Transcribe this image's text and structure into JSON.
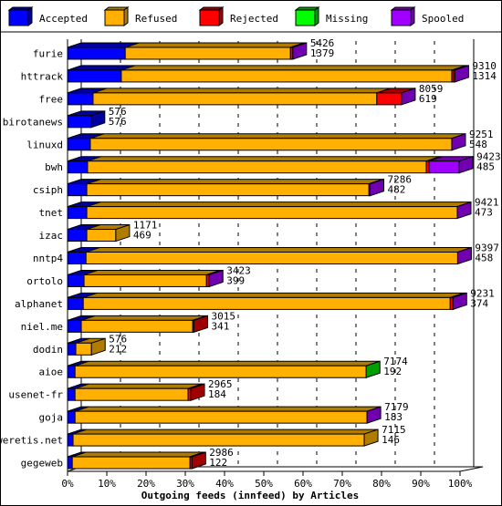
{
  "chart_data": {
    "type": "bar",
    "orientation": "horizontal",
    "stacked": true,
    "style": "3d",
    "title": "",
    "xlabel": "Outgoing feeds (innfeed) by Articles",
    "ylabel": "",
    "xlim": [
      0,
      100
    ],
    "x_unit": "%",
    "x_ticks": [
      "0%",
      "10%",
      "20%",
      "30%",
      "40%",
      "50%",
      "60%",
      "70%",
      "80%",
      "90%",
      "100%"
    ],
    "grid": true,
    "legend_position": "top",
    "legend": [
      {
        "name": "Accepted",
        "color": "#0000ff",
        "side": "#0000a0"
      },
      {
        "name": "Refused",
        "color": "#ffb000",
        "side": "#b07c00"
      },
      {
        "name": "Rejected",
        "color": "#ff0000",
        "side": "#a00000"
      },
      {
        "name": "Missing",
        "color": "#00ff00",
        "side": "#00a000"
      },
      {
        "name": "Spooled",
        "color": "#a000ff",
        "side": "#7000b0"
      }
    ],
    "categories": [
      "furie",
      "httrack",
      "free",
      "birotanews",
      "linuxd",
      "bwh",
      "csiph",
      "tnet",
      "izac",
      "nntp4",
      "ortolo",
      "alphanet",
      "niel.me",
      "dodin",
      "aioe",
      "usenet-fr",
      "goja",
      "weretis.net",
      "gegeweb"
    ],
    "series": [
      {
        "name": "Accepted",
        "values": [
          14.7,
          13.7,
          6.5,
          6.0,
          5.8,
          5.1,
          4.9,
          4.9,
          4.9,
          4.7,
          4.2,
          4.0,
          3.5,
          2.1,
          1.9,
          1.9,
          1.9,
          1.4,
          1.2
        ]
      },
      {
        "name": "Refused",
        "values": [
          42.1,
          84.2,
          72.3,
          0,
          92.1,
          86.3,
          71.9,
          94.4,
          7.4,
          94.7,
          31.2,
          93.5,
          28.4,
          4.0,
          74.2,
          28.8,
          74.4,
          74.2,
          30.0
        ]
      },
      {
        "name": "Rejected",
        "values": [
          0.6,
          0.5,
          6.3,
          0,
          0,
          0.7,
          0,
          0,
          0,
          0,
          0.7,
          0.7,
          0.3,
          0,
          0,
          0.7,
          0,
          0,
          0.5
        ]
      },
      {
        "name": "Missing",
        "values": [
          0,
          0.3,
          0,
          0,
          0,
          0,
          0,
          0,
          0,
          0,
          0,
          0,
          0,
          0,
          0,
          0,
          0,
          0,
          0
        ]
      },
      {
        "name": "Spooled",
        "values": [
          0,
          0,
          0,
          0,
          0,
          7.7,
          0.3,
          0,
          0,
          0,
          0,
          0,
          0,
          0,
          0,
          0,
          0,
          0,
          0
        ]
      }
    ],
    "end_colors": [
      "Spooled",
      "Spooled",
      "Spooled",
      "Accepted",
      "Spooled",
      "Spooled",
      "Spooled",
      "Spooled",
      "Refused",
      "Spooled",
      "Spooled",
      "Spooled",
      "Rejected",
      "Refused",
      "Missing",
      "Rejected",
      "Spooled",
      "Refused",
      "Rejected"
    ],
    "labels_top": [
      "5426",
      "9310",
      "8059",
      "576",
      "9251",
      "9423",
      "7286",
      "9421",
      "1171",
      "9397",
      "3423",
      "9231",
      "3015",
      "576",
      "7174",
      "2965",
      "7179",
      "7115",
      "2986"
    ],
    "labels_bottom": [
      "1379",
      "1314",
      "619",
      "576",
      "548",
      "485",
      "482",
      "473",
      "469",
      "458",
      "399",
      "374",
      "341",
      "212",
      "192",
      "184",
      "183",
      "146",
      "122"
    ]
  }
}
